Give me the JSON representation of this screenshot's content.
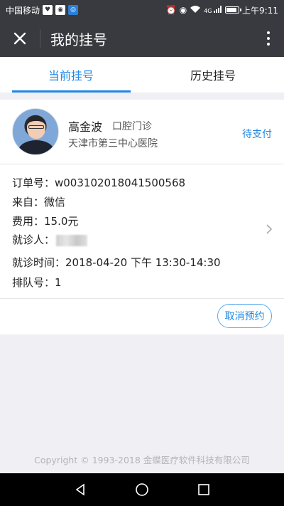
{
  "status_bar": {
    "carrier": "中国移动",
    "time": "上午9:11",
    "signal_label": "4G"
  },
  "nav": {
    "title": "我的挂号"
  },
  "tabs": [
    {
      "label": "当前挂号",
      "active": true
    },
    {
      "label": "历史挂号",
      "active": false
    }
  ],
  "appointment": {
    "doctor_name": "高金波",
    "department": "口腔门诊",
    "hospital": "天津市第三中心医院",
    "status": "待支付",
    "order_no": "订单号：w003102018041500568",
    "source": "来自：微信",
    "fee": "费用：15.0元",
    "patient_label": "就诊人：",
    "visit_time": "就诊时间：2018-04-20 下午 13:30-14:30",
    "queue_no": "排队号：1",
    "cancel_label": "取消预约"
  },
  "footer": {
    "copyright": "Copyright © 1993-2018 金蝶医疗软件科技有限公司"
  },
  "colors": {
    "accent": "#1e88e5",
    "nav_bg": "#393a3f",
    "page_bg": "#efeff4"
  }
}
